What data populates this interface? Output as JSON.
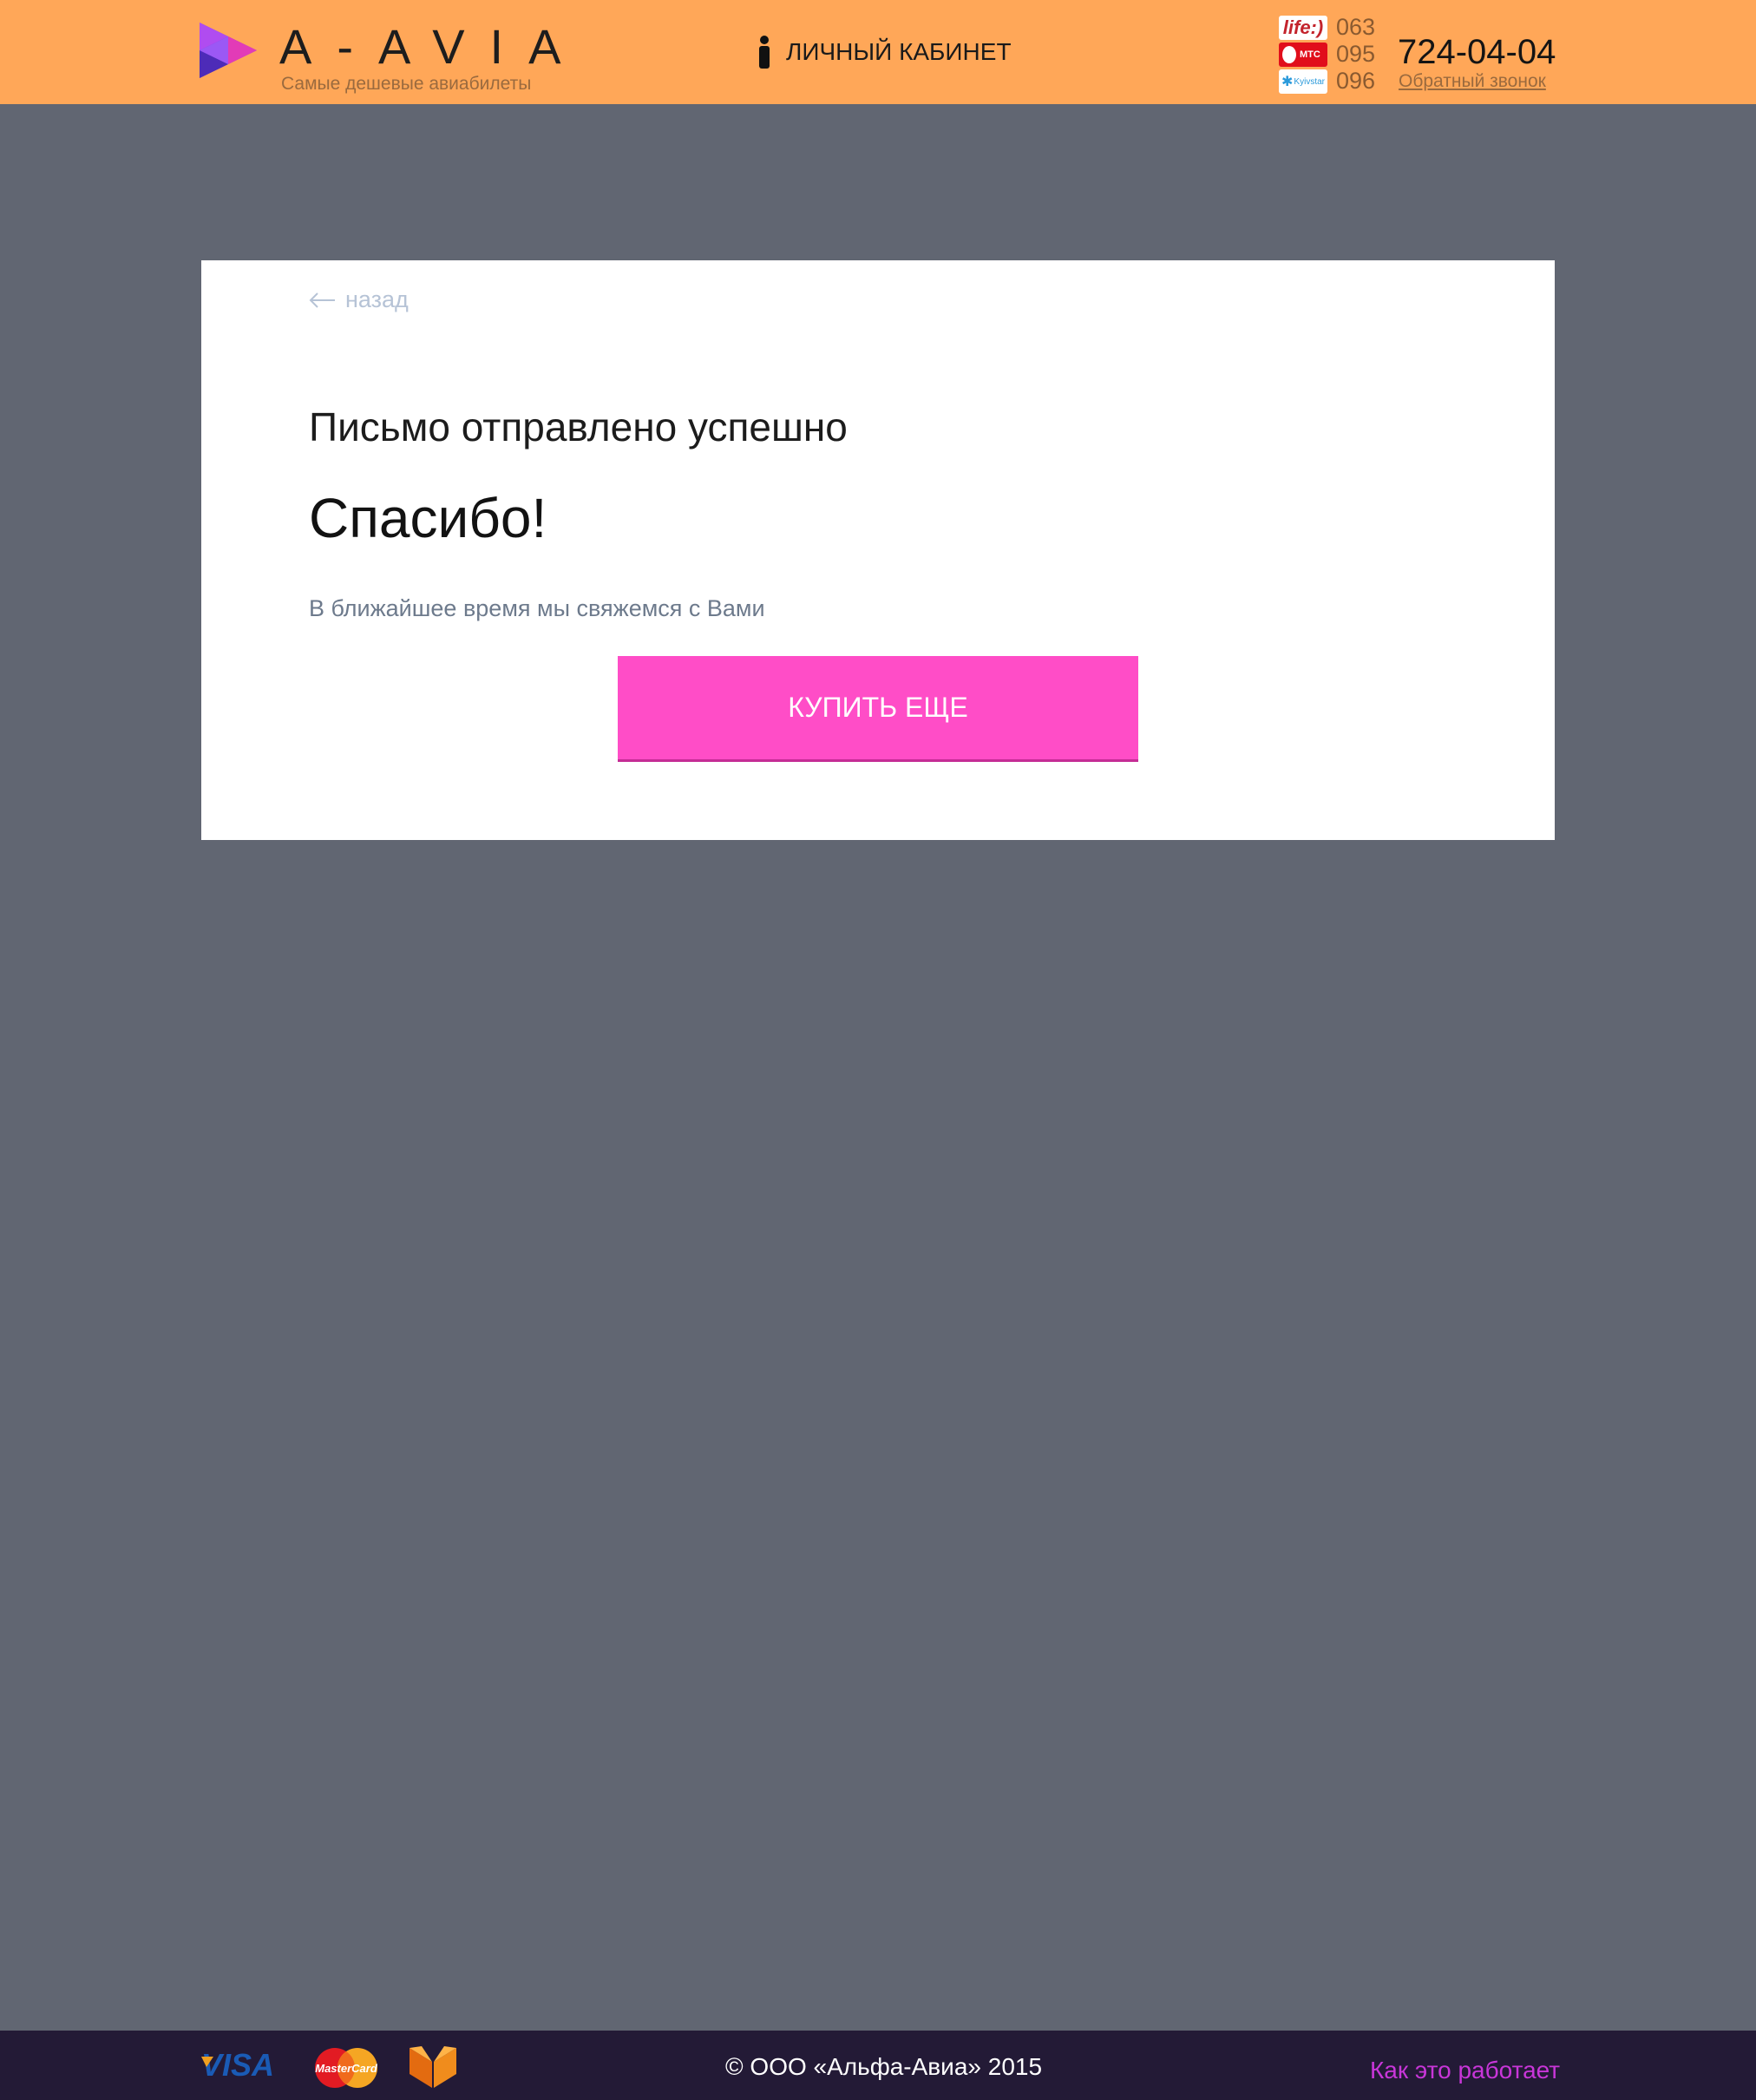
{
  "header": {
    "logo_text": "A-AVIA",
    "tagline": "Самые дешевые авиабилеты",
    "cabinet_label": "ЛИЧНЫЙ КАБИНЕТ",
    "operators": [
      {
        "name": "life:)",
        "code": "063"
      },
      {
        "name": "МТС",
        "code": "095"
      },
      {
        "name": "Kyivstar",
        "code": "096"
      }
    ],
    "phone": "724-04-04",
    "callback_label": "Обратный звонок"
  },
  "card": {
    "back_label": "назад",
    "title": "Письмо отправлено успешно",
    "thanks": "Спасибо!",
    "subtitle": "В ближайшее время мы свяжемся с Вами",
    "buy_button": "КУПИТЬ ЕЩЕ"
  },
  "footer": {
    "payments": [
      "VISA",
      "MasterCard",
      "payment-logo"
    ],
    "copyright": "© ООО «Альфа-Авиа» 2015",
    "how_it_works": "Как это работает"
  },
  "colors": {
    "header_bg": "#ffa758",
    "page_bg": "#616672",
    "button_bg": "#ff4dc7",
    "footer_bg": "#231a36",
    "link_purple": "#c836d8"
  }
}
